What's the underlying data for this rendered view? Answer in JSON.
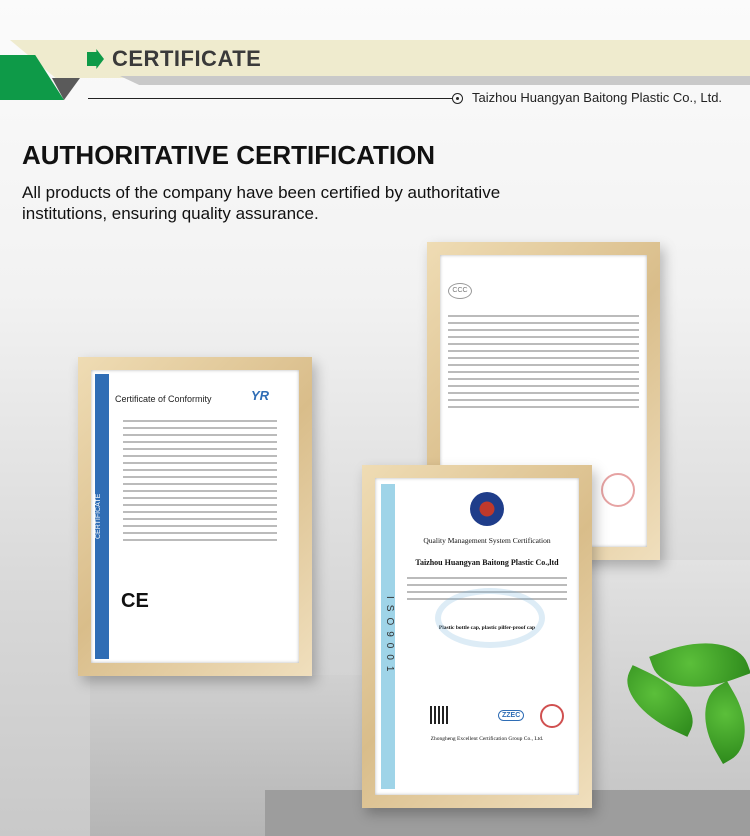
{
  "header": {
    "title": "CERTIFICATE",
    "company": "Taizhou Huangyan Baitong Plastic Co., Ltd."
  },
  "main": {
    "title": "AUTHORITATIVE CERTIFICATION",
    "subtitle": "All products of the company have been certified by authoritative institutions, ensuring quality assurance."
  },
  "certificates": {
    "ce": {
      "title": "Certificate of Conformity",
      "logo": "YR",
      "mark": "CE",
      "side_text": "CERTIFICATE"
    },
    "iso": {
      "title": "Quality Management System Certification",
      "company": "Taizhou Huangyan Baitong Plastic Co.,ltd",
      "product": "Plastic bottle cap, plastic pilfer-proof cap",
      "standard": "ISO9001",
      "issuer_logo": "ZZEC",
      "issuer": "Zhongheng Excellent Certification Group Co., Ltd."
    },
    "ccc": {
      "logo": "CCC"
    }
  },
  "colors": {
    "accent": "#0e9a48",
    "band": "#efebce"
  }
}
